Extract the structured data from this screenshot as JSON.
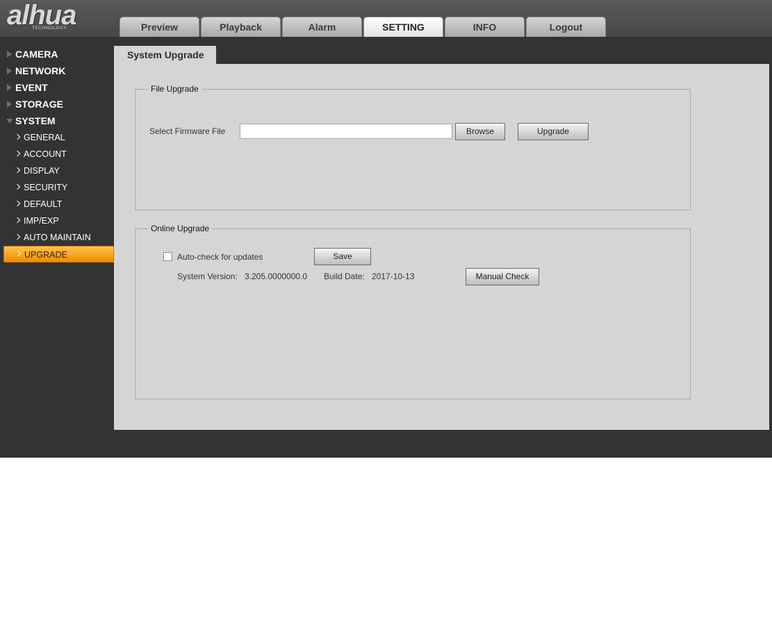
{
  "brand": {
    "logo_text": "alhua",
    "logo_sub": "TECHNOLOGY"
  },
  "nav": {
    "tabs": [
      {
        "label": "Preview",
        "active": false
      },
      {
        "label": "Playback",
        "active": false
      },
      {
        "label": "Alarm",
        "active": false
      },
      {
        "label": "SETTING",
        "active": true
      },
      {
        "label": "INFO",
        "active": false
      },
      {
        "label": "Logout",
        "active": false
      }
    ]
  },
  "sidebar": {
    "sections": [
      {
        "label": "CAMERA"
      },
      {
        "label": "NETWORK"
      },
      {
        "label": "EVENT"
      },
      {
        "label": "STORAGE"
      },
      {
        "label": "SYSTEM"
      }
    ],
    "system_items": [
      {
        "label": "GENERAL"
      },
      {
        "label": "ACCOUNT"
      },
      {
        "label": "DISPLAY"
      },
      {
        "label": "SECURITY"
      },
      {
        "label": "DEFAULT"
      },
      {
        "label": "IMP/EXP"
      },
      {
        "label": "AUTO MAINTAIN"
      },
      {
        "label": "UPGRADE"
      }
    ]
  },
  "page": {
    "tab_title": "System Upgrade"
  },
  "file_upgrade": {
    "legend": "File Upgrade",
    "select_label": "Select Firmware File",
    "file_value": "",
    "browse_label": "Browse",
    "upgrade_label": "Upgrade"
  },
  "online_upgrade": {
    "legend": "Online Upgrade",
    "auto_check_label": "Auto-check for updates",
    "auto_check_checked": false,
    "save_label": "Save",
    "version_label": "System Version:",
    "version_value": "3.205.0000000.0",
    "build_label": "Build Date:",
    "build_value": "2017-10-13",
    "manual_check_label": "Manual Check"
  },
  "colors": {
    "header_bg": "#4e4e4e",
    "app_bg": "#333333",
    "content_bg": "#d5d5d5",
    "active_item": "#f5a000"
  }
}
